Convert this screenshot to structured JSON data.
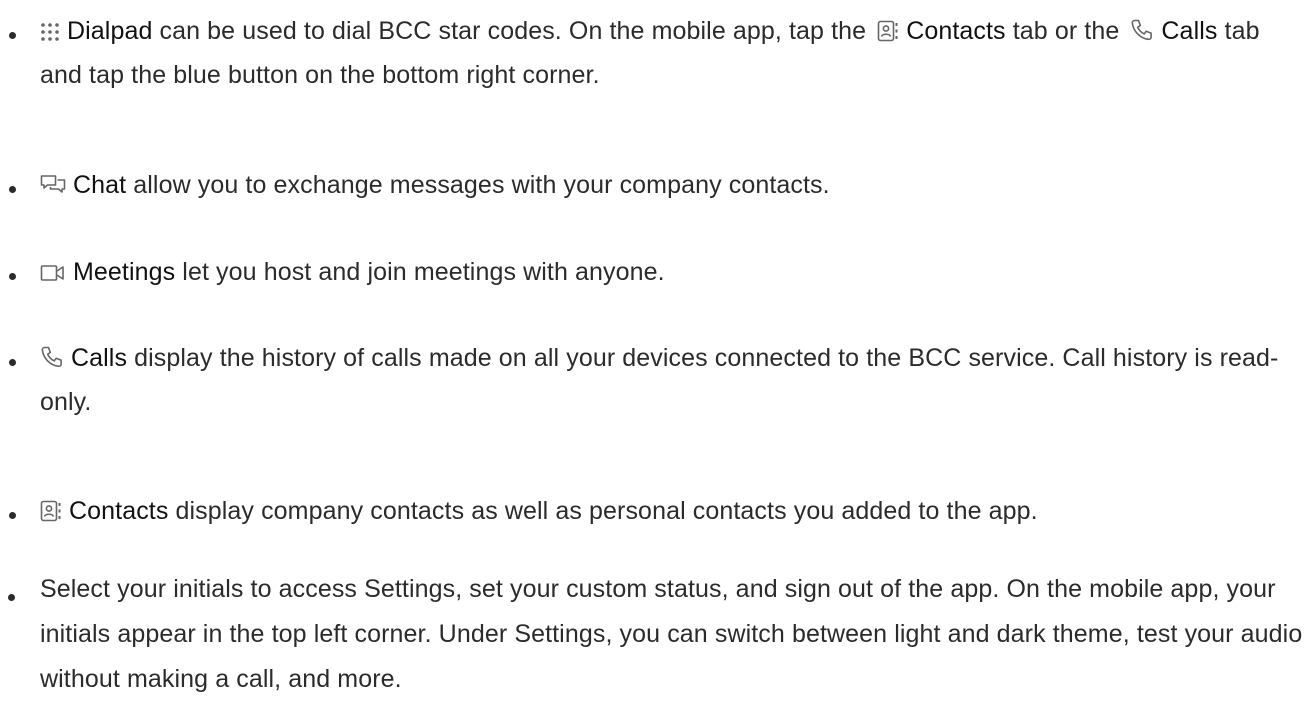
{
  "items": [
    {
      "icon": "dialpad-icon",
      "keyword": "Dialpad",
      "text_before_inline": " can be used to dial BCC star codes. On the mobile app, tap the ",
      "inline_icon_1": "contacts-icon",
      "inline_keyword_1": "Contacts",
      "text_between": " tab or the ",
      "inline_icon_2": "phone-icon",
      "inline_keyword_2": "Calls",
      "text_after": " tab and tap the blue button on the bottom right corner."
    },
    {
      "icon": "chat-icon",
      "keyword": "Chat",
      "text": " allow you to exchange messages with your company contacts."
    },
    {
      "icon": "video-camera-icon",
      "keyword": "Meetings",
      "text": " let you host and join meetings with anyone."
    },
    {
      "icon": "phone-icon",
      "keyword": "Calls",
      "text": " display the history of calls made on all your devices connected to the BCC service. Call history is read-only."
    },
    {
      "icon": "contacts-icon",
      "keyword": "Contacts",
      "text": " display company contacts as well as personal contacts you added to the app."
    },
    {
      "text": "Select your initials to access Settings, set your custom status, and sign out of the app. On the mobile app, your initials appear in the top left corner. Under Settings, you can switch between light and dark theme, test your audio without making a call, and more."
    }
  ],
  "colors": {
    "text": "#2b2b2b",
    "keyword": "#111111",
    "icon": "#666666"
  }
}
